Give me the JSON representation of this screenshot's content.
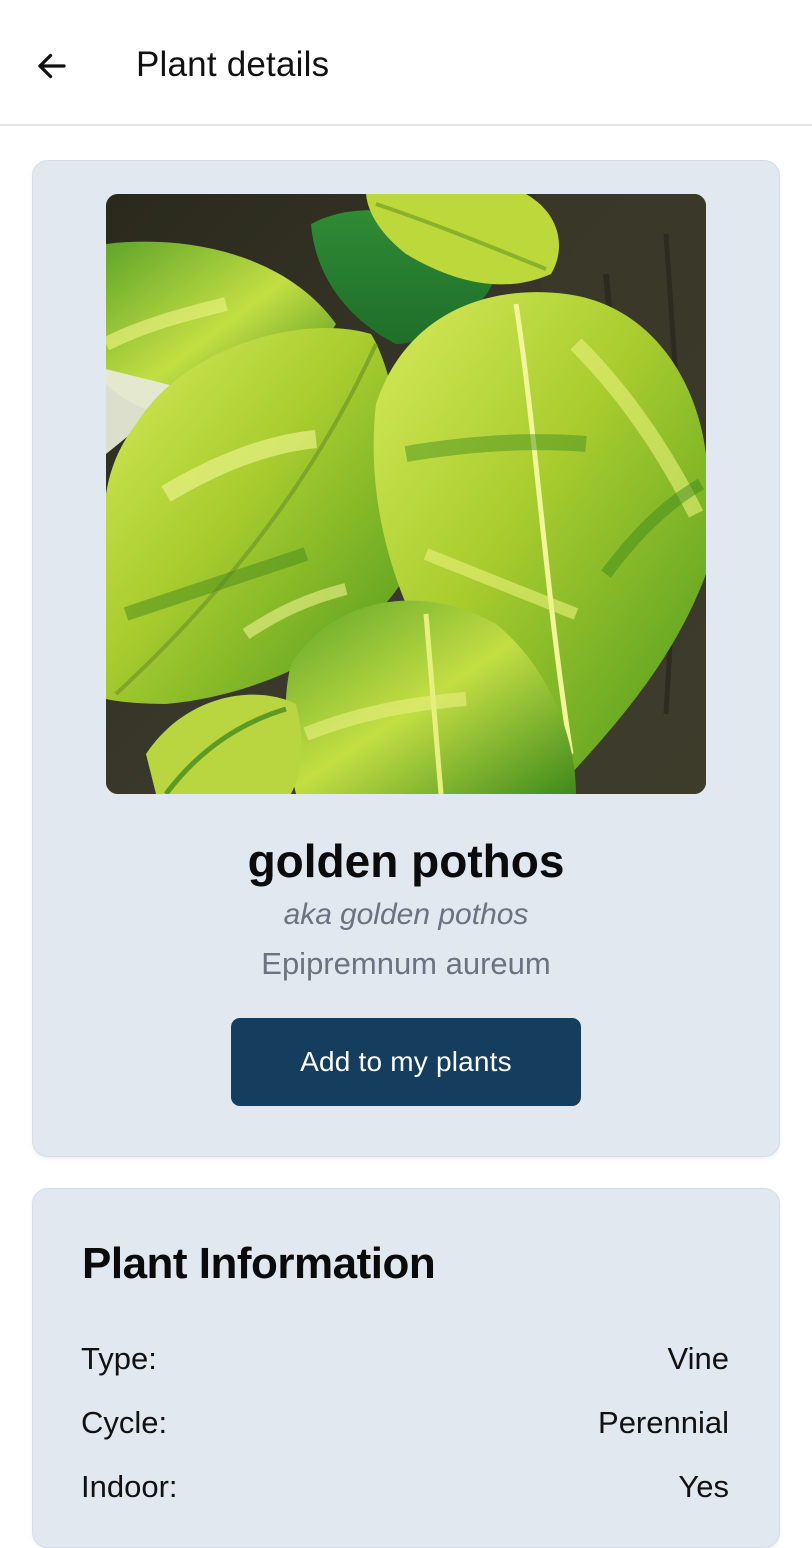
{
  "header": {
    "title": "Plant details",
    "back_icon": "arrow-left-icon"
  },
  "plant": {
    "common_name": "golden pothos",
    "aka_prefix": "aka",
    "aka": "golden pothos",
    "scientific_name": "Epipremnum aureum",
    "image_alt": "golden pothos photo"
  },
  "actions": {
    "add_label": "Add to my plants"
  },
  "info": {
    "title": "Plant Information",
    "rows": [
      {
        "label": "Type:",
        "value": "Vine"
      },
      {
        "label": "Cycle:",
        "value": "Perennial"
      },
      {
        "label": "Indoor:",
        "value": "Yes"
      }
    ]
  },
  "colors": {
    "card_bg": "#e2e8f0",
    "button_bg": "#153d5e",
    "muted_text": "#6b7280"
  }
}
